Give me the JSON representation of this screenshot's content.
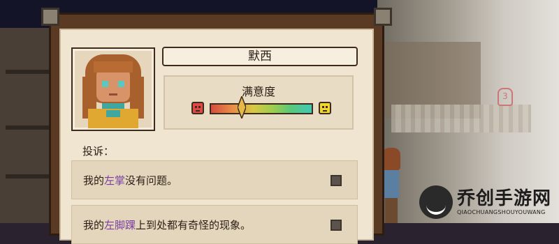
{
  "character": {
    "name": "默西",
    "portrait_icon": "character-portrait"
  },
  "satisfaction": {
    "label": "满意度",
    "level": 0.31,
    "low_icon": "angry-face-icon",
    "high_icon": "happy-face-icon",
    "colors": [
      "#d44c40",
      "#e88a46",
      "#d8c844",
      "#9ccc50",
      "#58c87c",
      "#42c8b4"
    ]
  },
  "complaints": {
    "label": "投诉：",
    "items": [
      {
        "prefix": "我的",
        "highlight": "左掌",
        "suffix": "没有问题。",
        "checked": true
      },
      {
        "prefix": "我的",
        "highlight": "左脚踝",
        "suffix": "上到处都有奇怪的现象。",
        "checked": false
      }
    ]
  },
  "scene": {
    "marker_number": "3"
  },
  "watermark": {
    "title": "乔创手游网",
    "subtitle": "QIAOCHUANGSHOUYOUWANG"
  }
}
